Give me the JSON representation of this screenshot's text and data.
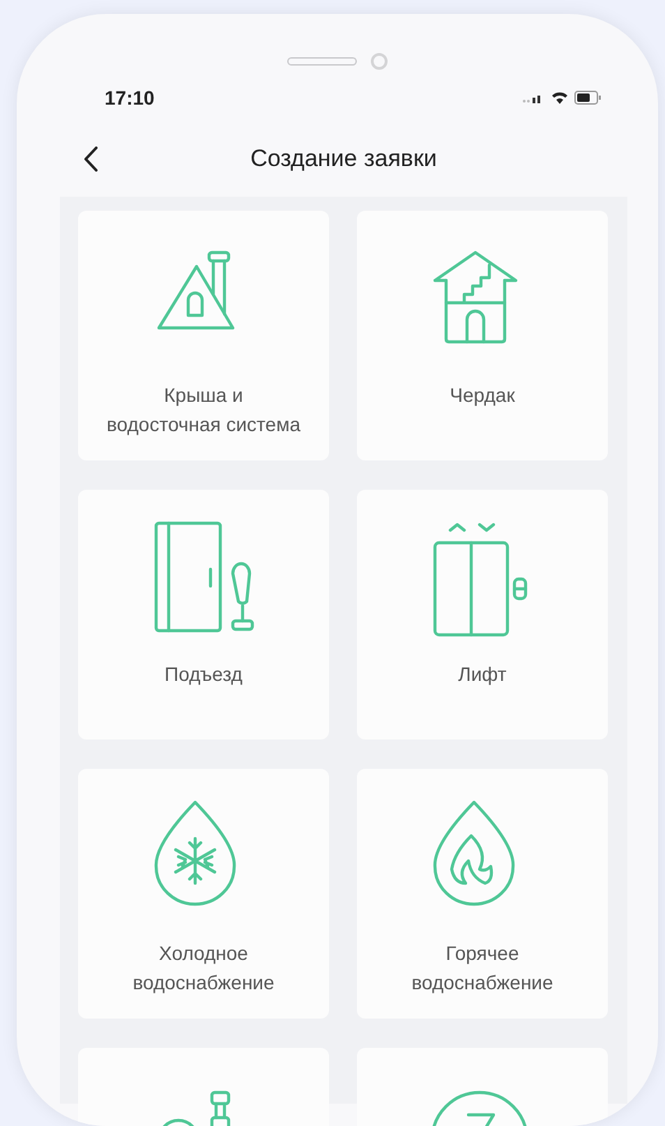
{
  "status_bar": {
    "time": "17:10"
  },
  "header": {
    "title": "Создание заявки"
  },
  "categories": [
    {
      "kind": "roof",
      "label": "Крыша и водосточная система"
    },
    {
      "kind": "attic",
      "label": "Чердак"
    },
    {
      "kind": "entrance",
      "label": "Подъезд"
    },
    {
      "kind": "elevator",
      "label": "Лифт"
    },
    {
      "kind": "cold-water",
      "label": "Холодное водоснабжение"
    },
    {
      "kind": "hot-water",
      "label": "Горячее водоснабжение"
    },
    {
      "kind": "pipe"
    },
    {
      "kind": "electricity"
    }
  ]
}
